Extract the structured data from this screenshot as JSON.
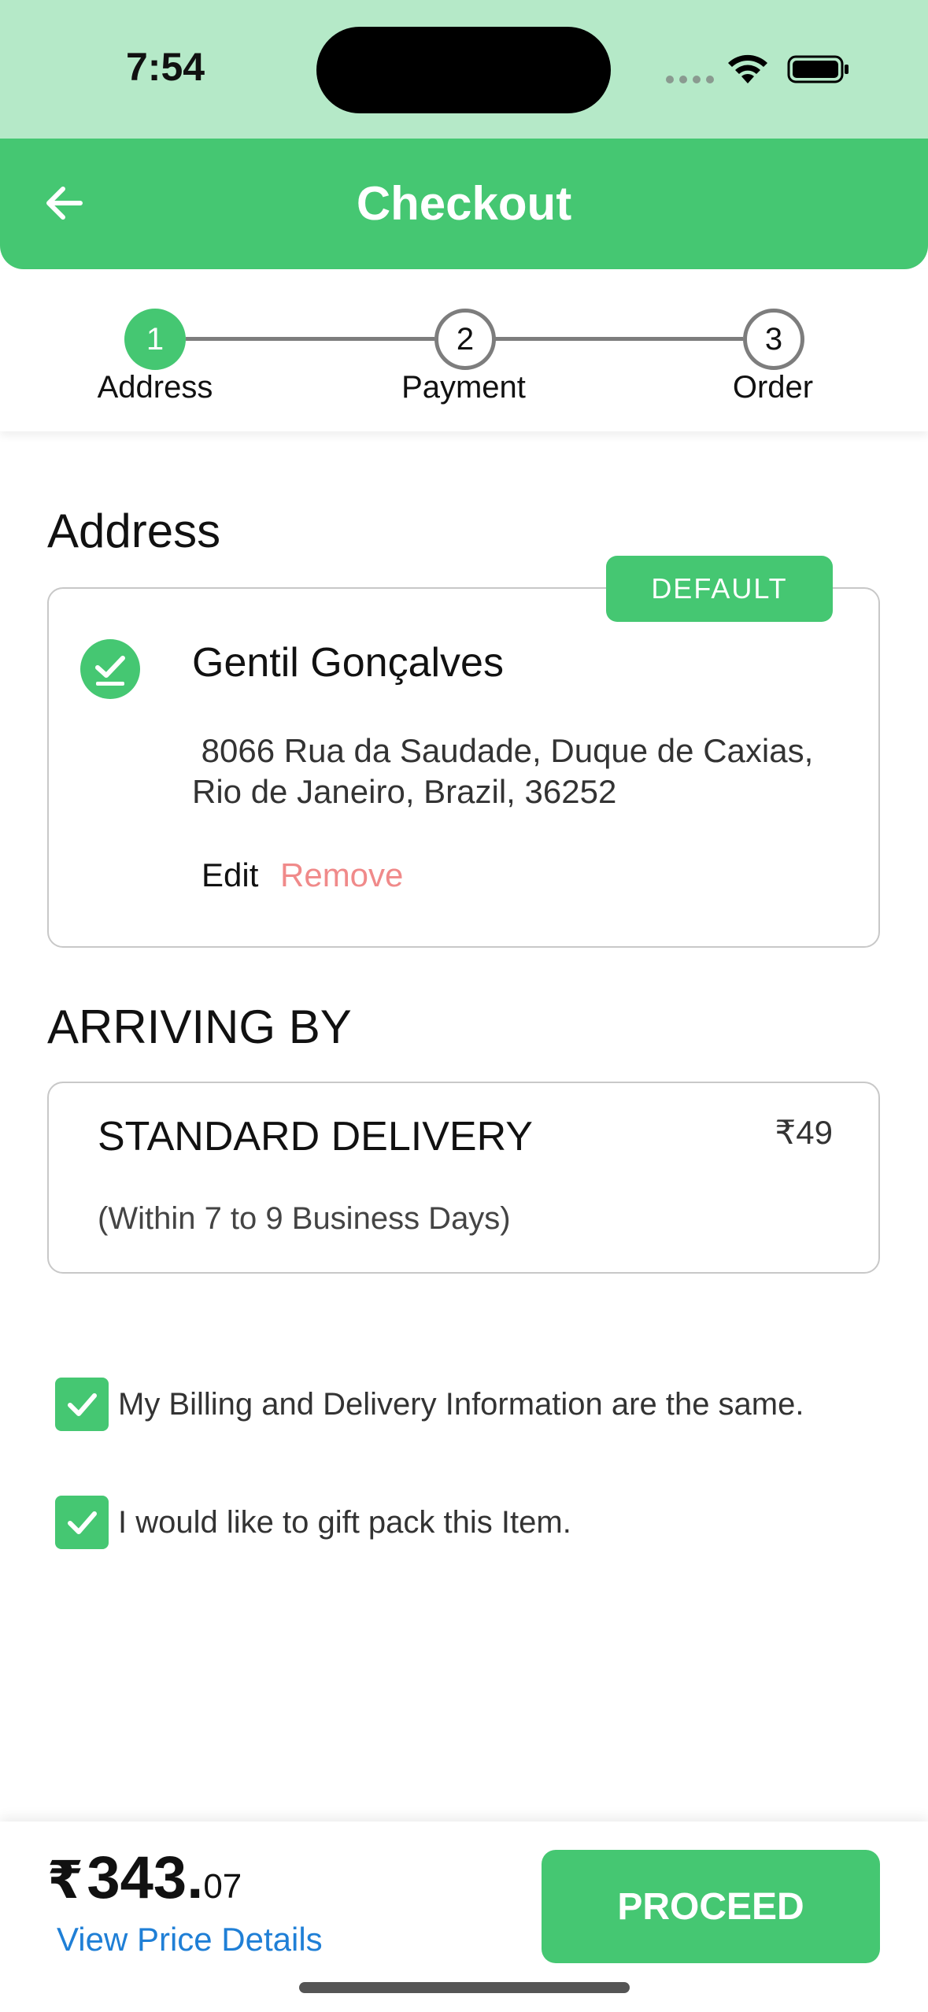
{
  "status_bar": {
    "time": "7:54"
  },
  "header": {
    "title": "Checkout"
  },
  "stepper": {
    "steps": [
      {
        "number": "1",
        "label": "Address"
      },
      {
        "number": "2",
        "label": "Payment"
      },
      {
        "number": "3",
        "label": "Order"
      }
    ],
    "active_step": 1
  },
  "address_section": {
    "title": "Address",
    "badge": "DEFAULT",
    "name": "Gentil Gonçalves",
    "address_line1": " 8066 Rua da Saudade, Duque de Caxias,",
    "address_line2": "Rio de Janeiro, Brazil, 36252",
    "edit_label": "Edit",
    "remove_label": "Remove"
  },
  "arriving_section": {
    "title": "ARRIVING BY",
    "delivery_type": "STANDARD DELIVERY",
    "price": "₹49",
    "subtitle": "(Within 7 to 9 Business Days)"
  },
  "options": {
    "billing_same_label": "My Billing and Delivery Information are the same.",
    "billing_same_checked": true,
    "gift_pack_label": "I would like to gift pack this Item.",
    "gift_pack_checked": true
  },
  "footer": {
    "currency": "₹",
    "total_main": "343.",
    "total_decimal": "07",
    "view_details_label": "View Price Details",
    "proceed_label": "PROCEED"
  },
  "colors": {
    "accent": "#45c772",
    "status_bar_bg": "#b5e9c8",
    "remove": "#f08a8a",
    "link": "#1f7fd6"
  }
}
